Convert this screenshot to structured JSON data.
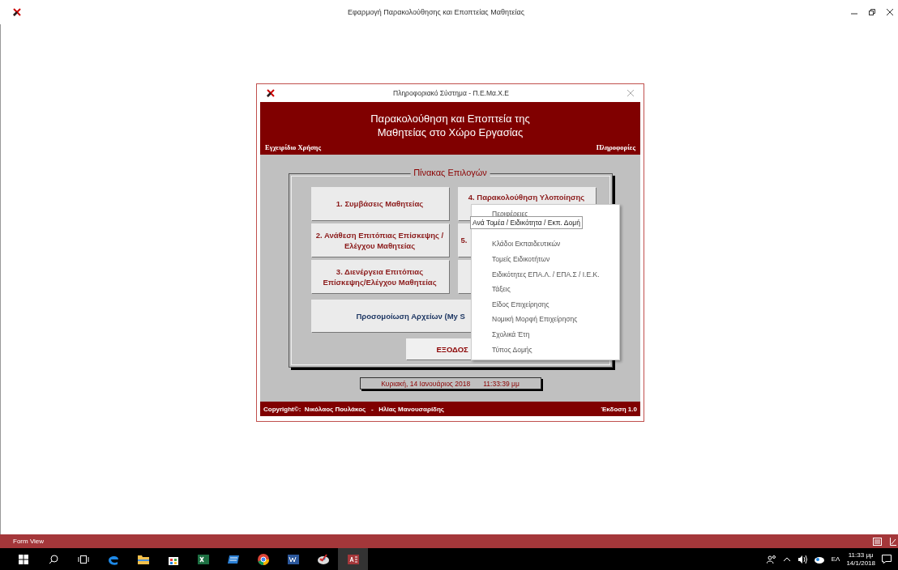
{
  "app_window": {
    "title": "Εφαρμογή Παρακολούθησης και Εποπτείας Μαθητείας"
  },
  "dialog": {
    "title": "Πληροφοριακό Σύστημα - Π.Ε.Μα.Χ.Ε",
    "heading": [
      "Παρακολούθηση και Εποπτεία  της",
      "Μαθητείας στο Χώρο Εργασίας"
    ],
    "left_link": "Εγχειρίδιο Χρήσης",
    "right_link": "Πληροφορίες",
    "panel_title": "Πίνακας Επιλογών",
    "menu_buttons": [
      {
        "label": "1. Συμβάσεις Μαθητείας"
      },
      {
        "label": "2. Ανάθεση Επιτόπιας Επίσκεψης / Ελέγχου Μαθητείας"
      },
      {
        "label": "3. Διενέργεια Επιτόπιας Επίσκεψης/Ελέγχου Μαθητείας"
      },
      {
        "label": "4. Παρακολούθηση Υλοποίησης"
      },
      {
        "label": "5."
      },
      {
        "covered": true
      }
    ],
    "wide_button": "Προσομοίωση Αρχείων (My S",
    "exit_button": "ΕΞΟΔΟΣ",
    "date": "Κυριακή, 14 Ιανουάριος 2018",
    "time": "11:33:39 μμ",
    "copyright": "Copyright©:  Νικόλαος Πουλάκος   -   Ηλίας Μανουσαρίδης",
    "version": "Έκδοση 1.0"
  },
  "dropdown_menu": {
    "items": [
      {
        "label": "Περιφέρειες"
      },
      {
        "covered": true
      },
      {
        "label": "Κλάδοι Εκπαιδευτικών"
      },
      {
        "label": "Τομείς Ειδικοτήτων"
      },
      {
        "label": "Ειδικότητες ΕΠΑ.Λ. / ΕΠΑ.Σ / Ι.Ε.Κ."
      },
      {
        "label": "Τάξεις"
      },
      {
        "label": "Είδος Επιχείρησης"
      },
      {
        "label": "Νομική Μορφή Επιχείρησης"
      },
      {
        "label": "Σχολικά Έτη"
      },
      {
        "label": "Τύπος Δομής"
      }
    ]
  },
  "tooltip": "Ανά Τομέα / Ειδικότητα / Εκπ. Δομή",
  "status_bar": {
    "text": "Form View"
  },
  "taskbar": {
    "apps": [
      {
        "kind": "edge",
        "selected": false
      },
      {
        "kind": "folder",
        "selected": false
      },
      {
        "kind": "store",
        "selected": false
      },
      {
        "kind": "excel",
        "selected": false
      },
      {
        "kind": "window",
        "selected": false
      },
      {
        "kind": "chrome",
        "selected": false
      },
      {
        "kind": "word",
        "selected": false
      },
      {
        "kind": "paint",
        "selected": false
      },
      {
        "kind": "access",
        "selected": true
      }
    ],
    "language": "ΕΛ",
    "time": "11:33 μμ",
    "date": "14/1/2018"
  }
}
